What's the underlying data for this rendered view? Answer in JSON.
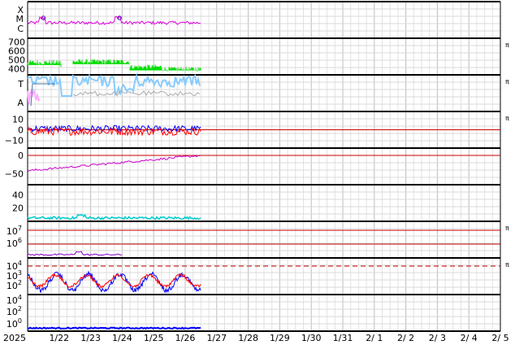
{
  "chart_data": {
    "type": "line",
    "x_start": "2025-01-21",
    "x_end": "2025-02-05",
    "data_end": "2025-01-26T12:00",
    "x_tick_labels": [
      "2025",
      "1/22",
      "1/23",
      "1/24",
      "1/25",
      "1/26",
      "1/27",
      "1/28",
      "1/29",
      "1/30",
      "1/31",
      "2/ 1",
      "2/ 2",
      "2/ 3",
      "2/ 4",
      "2/ 5"
    ],
    "right_marker": "π",
    "colors": {
      "xray": "#e000e0",
      "wind_speed": "#00dd00",
      "bt": "#88ccff",
      "b_alt": "#ffaaff",
      "b_grey": "#aaaaaa",
      "bz_blue": "#0000ff",
      "bz_red": "#ff0000",
      "kp_like": "#cc00cc",
      "density": "#00cccc",
      "threshold": "#cc0000",
      "electron": "#8800cc"
    },
    "panels": [
      {
        "id": "xray",
        "tick_labels": [
          "X",
          "M",
          "C"
        ],
        "flare_markers": [
          "2025-01-21T12:00",
          "2025-01-23T22:00"
        ],
        "right_marker": false
      },
      {
        "id": "wind-speed",
        "tick_labels": [
          "700",
          "600",
          "500",
          "400"
        ],
        "ylim": [
          330,
          740
        ],
        "right_marker": true
      },
      {
        "id": "imf-bt",
        "tick_labels": [
          "T",
          "A"
        ],
        "right_marker": true
      },
      {
        "id": "imf-bz",
        "tick_labels": [
          "10",
          "0",
          "−10"
        ],
        "ylim": [
          -17,
          17
        ],
        "right_marker": true
      },
      {
        "id": "dst",
        "tick_labels": [
          "0",
          "−50"
        ],
        "ylim": [
          -80,
          20
        ],
        "right_marker": false
      },
      {
        "id": "density",
        "tick_labels": [
          "40",
          "20"
        ],
        "ylim": [
          0,
          55
        ],
        "right_marker": false
      },
      {
        "id": "electron-flux",
        "tick_labels": [
          "10^7",
          "10^6"
        ],
        "right_marker": true
      },
      {
        "id": "proton-flux",
        "tick_labels": [
          "10^4",
          "10^3",
          "10^2"
        ],
        "right_marker": true
      },
      {
        "id": "high-energy",
        "tick_labels": [
          "10^4",
          "10^2",
          "10^0"
        ],
        "right_marker": false
      }
    ]
  }
}
